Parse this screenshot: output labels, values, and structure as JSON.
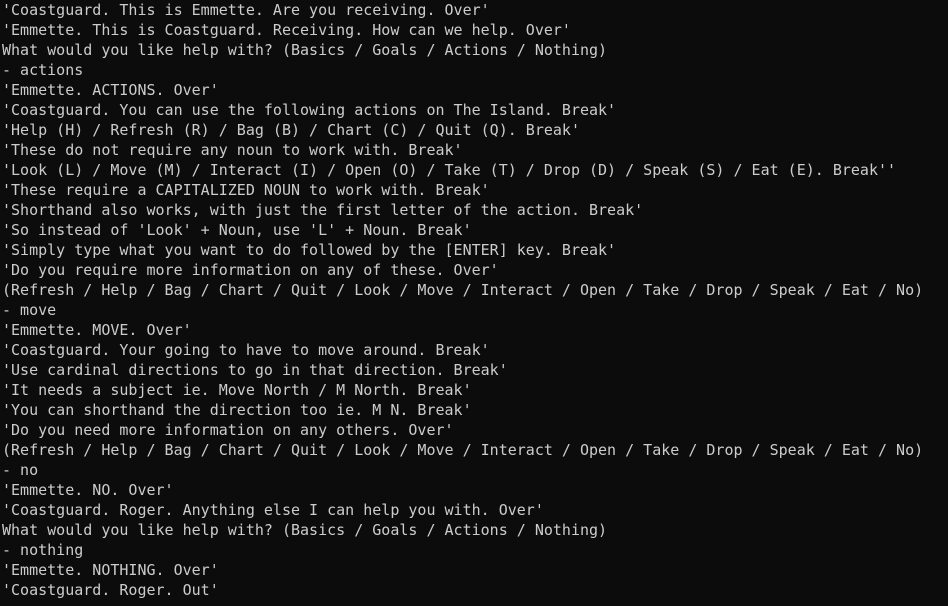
{
  "terminal": {
    "colors": {
      "background": "#0c0c0c",
      "text": "#cccccc"
    },
    "lines": [
      "'Coastguard. This is Emmette. Are you receiving. Over'",
      "'Emmette. This is Coastguard. Receiving. How can we help. Over'",
      "What would you like help with? (Basics / Goals / Actions / Nothing)",
      "- actions",
      "'Emmette. ACTIONS. Over'",
      "'Coastguard. You can use the following actions on The Island. Break'",
      "'Help (H) / Refresh (R) / Bag (B) / Chart (C) / Quit (Q). Break'",
      "'These do not require any noun to work with. Break'",
      "'Look (L) / Move (M) / Interact (I) / Open (O) / Take (T) / Drop (D) / Speak (S) / Eat (E). Break''",
      "'These require a CAPITALIZED NOUN to work with. Break'",
      "'Shorthand also works, with just the first letter of the action. Break'",
      "'So instead of 'Look' + Noun, use 'L' + Noun. Break'",
      "'Simply type what you want to do followed by the [ENTER] key. Break'",
      "'Do you require more information on any of these. Over'",
      "(Refresh / Help / Bag / Chart / Quit / Look / Move / Interact / Open / Take / Drop / Speak / Eat / No)",
      "- move",
      "'Emmette. MOVE. Over'",
      "'Coastguard. Your going to have to move around. Break'",
      "'Use cardinal directions to go in that direction. Break'",
      "'It needs a subject ie. Move North / M North. Break'",
      "'You can shorthand the direction too ie. M N. Break'",
      "'Do you need more information on any others. Over'",
      "(Refresh / Help / Bag / Chart / Quit / Look / Move / Interact / Open / Take / Drop / Speak / Eat / No)",
      "- no",
      "'Emmette. NO. Over'",
      "'Coastguard. Roger. Anything else I can help you with. Over'",
      "What would you like help with? (Basics / Goals / Actions / Nothing)",
      "- nothing",
      "'Emmette. NOTHING. Over'",
      "'Coastguard. Roger. Out'"
    ]
  }
}
